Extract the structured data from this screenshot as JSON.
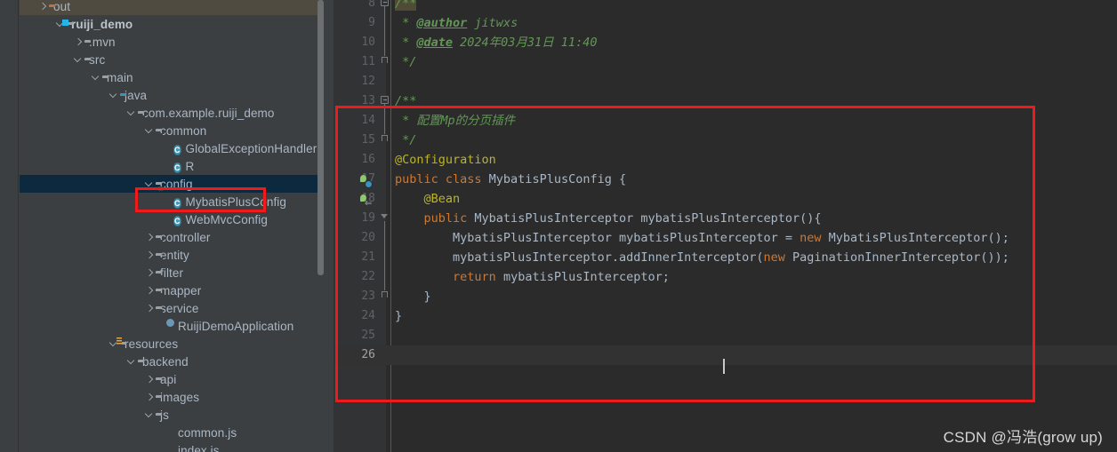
{
  "sidebar": {
    "name": "project-tree",
    "scrollbar": {
      "name": "vertical-scrollbar"
    },
    "items": [
      {
        "label": "out",
        "icon": "folder-orange-icon",
        "indent": 0,
        "arrow": "right",
        "state": "excluded"
      },
      {
        "label": "ruiji_demo",
        "icon": "module-icon",
        "indent": 1,
        "arrow": "down",
        "state": "module"
      },
      {
        "label": ".mvn",
        "icon": "folder-icon",
        "indent": 2,
        "arrow": "right",
        "state": "normal"
      },
      {
        "label": "src",
        "icon": "folder-icon",
        "indent": 2,
        "arrow": "down",
        "state": "normal"
      },
      {
        "label": "main",
        "icon": "folder-icon",
        "indent": 3,
        "arrow": "down",
        "state": "normal"
      },
      {
        "label": "java",
        "icon": "folder-blue-icon",
        "indent": 4,
        "arrow": "down",
        "state": "normal"
      },
      {
        "label": "com.example.ruiji_demo",
        "icon": "package-icon",
        "indent": 5,
        "arrow": "down",
        "state": "normal"
      },
      {
        "label": "common",
        "icon": "package-icon",
        "indent": 6,
        "arrow": "down",
        "state": "normal"
      },
      {
        "label": "GlobalExceptionHandler",
        "icon": "java-class-icon",
        "indent": 7,
        "arrow": "none",
        "state": "normal"
      },
      {
        "label": "R",
        "icon": "java-class-icon",
        "indent": 7,
        "arrow": "none",
        "state": "normal"
      },
      {
        "label": "config",
        "icon": "package-icon",
        "indent": 6,
        "arrow": "down",
        "state": "selected"
      },
      {
        "label": "MybatisPlusConfig",
        "icon": "java-class-icon",
        "indent": 7,
        "arrow": "none",
        "state": "highlighted"
      },
      {
        "label": "WebMvcConfig",
        "icon": "java-class-icon",
        "indent": 7,
        "arrow": "none",
        "state": "normal"
      },
      {
        "label": "controller",
        "icon": "package-icon",
        "indent": 6,
        "arrow": "right",
        "state": "normal"
      },
      {
        "label": "entity",
        "icon": "package-icon",
        "indent": 6,
        "arrow": "right",
        "state": "normal"
      },
      {
        "label": "filter",
        "icon": "package-icon",
        "indent": 6,
        "arrow": "right",
        "state": "normal"
      },
      {
        "label": "mapper",
        "icon": "package-icon",
        "indent": 6,
        "arrow": "right",
        "state": "normal"
      },
      {
        "label": "service",
        "icon": "package-icon",
        "indent": 6,
        "arrow": "right",
        "state": "normal"
      },
      {
        "label": "RuijiDemoApplication",
        "icon": "spring-boot-icon",
        "indent": 7,
        "arrow": "none",
        "state": "normal"
      },
      {
        "label": "resources",
        "icon": "resources-icon",
        "indent": 4,
        "arrow": "down",
        "state": "normal"
      },
      {
        "label": "backend",
        "icon": "folder-icon",
        "indent": 5,
        "arrow": "down",
        "state": "normal"
      },
      {
        "label": "api",
        "icon": "folder-icon",
        "indent": 6,
        "arrow": "right",
        "state": "normal"
      },
      {
        "label": "images",
        "icon": "folder-icon",
        "indent": 6,
        "arrow": "right",
        "state": "normal"
      },
      {
        "label": "js",
        "icon": "folder-icon",
        "indent": 6,
        "arrow": "down",
        "state": "normal"
      },
      {
        "label": "common.js",
        "icon": "js-file-icon",
        "indent": 7,
        "arrow": "none",
        "state": "normal"
      },
      {
        "label": "index.js",
        "icon": "js-file-icon",
        "indent": 7,
        "arrow": "none",
        "state": "normal"
      }
    ]
  },
  "editor": {
    "name": "code-editor",
    "file": "MybatisPlusConfig",
    "current_line": 26,
    "lines": [
      {
        "num": 8,
        "fold": "minus",
        "gutter_icon": "none",
        "segments": [
          {
            "text": "/**",
            "style": "comment-highlight"
          }
        ]
      },
      {
        "num": 9,
        "fold": "line",
        "gutter_icon": "none",
        "segments": [
          {
            "text": " * ",
            "style": "comment"
          },
          {
            "text": "@author",
            "style": "comment-tag"
          },
          {
            "text": " jitwxs",
            "style": "comment"
          }
        ]
      },
      {
        "num": 10,
        "fold": "line",
        "gutter_icon": "none",
        "segments": [
          {
            "text": " * ",
            "style": "comment"
          },
          {
            "text": "@date",
            "style": "comment-tag"
          },
          {
            "text": " 2024年03月31日 11:40",
            "style": "comment"
          }
        ]
      },
      {
        "num": 11,
        "fold": "end",
        "gutter_icon": "none",
        "segments": [
          {
            "text": " */",
            "style": "comment"
          }
        ]
      },
      {
        "num": 12,
        "fold": "none",
        "gutter_icon": "none",
        "segments": []
      },
      {
        "num": 13,
        "fold": "minus",
        "gutter_icon": "none",
        "segments": [
          {
            "text": "/**",
            "style": "comment"
          }
        ]
      },
      {
        "num": 14,
        "fold": "line",
        "gutter_icon": "none",
        "segments": [
          {
            "text": " * 配置Mp的分页插件",
            "style": "comment"
          }
        ]
      },
      {
        "num": 15,
        "fold": "end",
        "gutter_icon": "none",
        "segments": [
          {
            "text": " */",
            "style": "comment"
          }
        ]
      },
      {
        "num": 16,
        "fold": "none",
        "gutter_icon": "none",
        "segments": [
          {
            "text": "@Configuration",
            "style": "annotation"
          }
        ]
      },
      {
        "num": 17,
        "fold": "none",
        "gutter_icon": "spring-bean-icon",
        "segments": [
          {
            "text": "public class ",
            "style": "keyword-public-class"
          },
          {
            "text": "MybatisPlusConfig {",
            "style": "plain"
          }
        ]
      },
      {
        "num": 18,
        "fold": "none",
        "gutter_icon": "bean-arrow-icon",
        "segments": [
          {
            "text": "    ",
            "style": "plain"
          },
          {
            "text": "@Bean",
            "style": "annotation"
          }
        ]
      },
      {
        "num": 19,
        "fold": "triangle",
        "gutter_icon": "none",
        "segments": [
          {
            "text": "    ",
            "style": "plain"
          },
          {
            "text": "public ",
            "style": "keyword"
          },
          {
            "text": "MybatisPlusInterceptor mybatisPlusInterceptor(){",
            "style": "plain"
          }
        ]
      },
      {
        "num": 20,
        "fold": "line",
        "gutter_icon": "none",
        "segments": [
          {
            "text": "        MybatisPlusInterceptor mybatisPlusInterceptor = ",
            "style": "plain"
          },
          {
            "text": "new ",
            "style": "keyword"
          },
          {
            "text": "MybatisPlusInterceptor();",
            "style": "plain"
          }
        ]
      },
      {
        "num": 21,
        "fold": "line",
        "gutter_icon": "none",
        "segments": [
          {
            "text": "        mybatisPlusInterceptor.addInnerInterceptor(",
            "style": "plain"
          },
          {
            "text": "new ",
            "style": "keyword"
          },
          {
            "text": "PaginationInnerInterceptor());",
            "style": "plain"
          }
        ]
      },
      {
        "num": 22,
        "fold": "line",
        "gutter_icon": "none",
        "segments": [
          {
            "text": "        ",
            "style": "plain"
          },
          {
            "text": "return ",
            "style": "keyword"
          },
          {
            "text": "mybatisPlusInterceptor;",
            "style": "plain"
          }
        ]
      },
      {
        "num": 23,
        "fold": "end",
        "gutter_icon": "none",
        "segments": [
          {
            "text": "    }",
            "style": "plain"
          }
        ]
      },
      {
        "num": 24,
        "fold": "none",
        "gutter_icon": "none",
        "segments": [
          {
            "text": "}",
            "style": "plain"
          }
        ]
      },
      {
        "num": 25,
        "fold": "none",
        "gutter_icon": "none",
        "segments": []
      },
      {
        "num": 26,
        "fold": "none",
        "gutter_icon": "none",
        "segments": []
      }
    ]
  },
  "annotations": {
    "red_box_tree": {
      "name": "red-highlight-tree",
      "target": "MybatisPlusConfig"
    },
    "red_box_code": {
      "name": "red-highlight-code",
      "target": "lines 13-26"
    }
  },
  "watermark": {
    "text": "CSDN @冯浩(grow up)"
  },
  "colors": {
    "sidebar_bg": "#3c3f41",
    "editor_bg": "#2b2b2b",
    "gutter_bg": "#313335",
    "selection_blue": "#0d293e",
    "excluded_olive": "#4f4b41",
    "highlight_red": "#f01a1a",
    "comment_green": "#629755",
    "keyword_orange": "#cc7832",
    "annotation_yellow": "#bbb529",
    "text_gray": "#a9b7c6"
  }
}
